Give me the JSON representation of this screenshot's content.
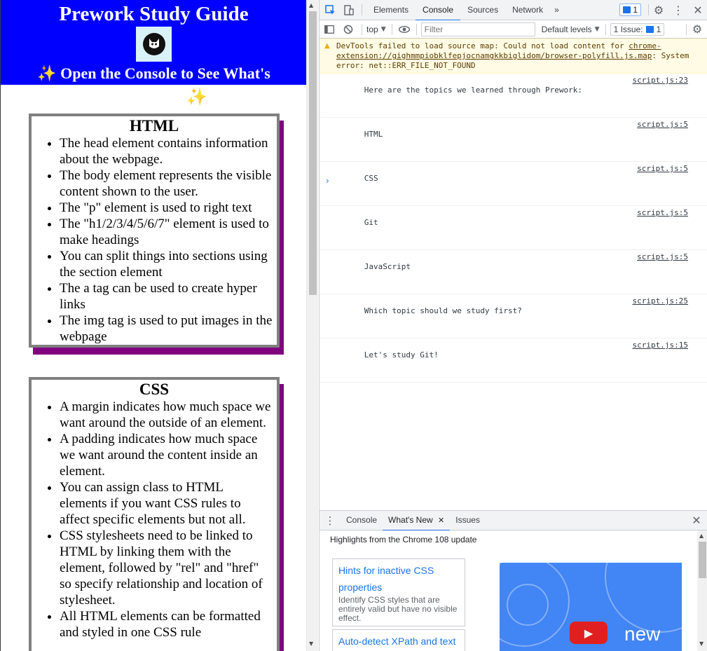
{
  "page": {
    "title": "Prework Study Guide",
    "subtitle": "Open the Console to See What's",
    "sparkle": "✨",
    "colors": {
      "banner": "#0000ff",
      "card_border": "#808080",
      "card_shadow": "#800080"
    },
    "cards": [
      {
        "heading": "HTML",
        "items": [
          "The head element contains information about the webpage.",
          "The body element represents the visible content shown to the user.",
          "The \"p\" element is used to right text",
          "The \"h1/2/3/4/5/6/7\" element is used to make headings",
          "You can split things into sections using the section element",
          "The a tag can be used to create hyper links",
          "The img tag is used to put images in the webpage"
        ]
      },
      {
        "heading": "CSS",
        "items": [
          "A margin indicates how much space we want around the outside of an element.",
          "A padding indicates how much space we want around the content inside an element.",
          "You can assign class to HTML elements if you want CSS rules to affect specific elements but not all.",
          "CSS stylesheets need to be linked to HTML by linking them with the element, followed by \"rel\" and \"href\" so specify relationship and location of stylesheet.",
          "All HTML elements can be formatted and styled in one CSS rule"
        ]
      }
    ]
  },
  "devtools": {
    "tabs": [
      "Elements",
      "Console",
      "Sources",
      "Network"
    ],
    "active_tab": "Console",
    "more_tabs": "»",
    "message_badge": "1",
    "toolbar": {
      "context": "top",
      "filter_placeholder": "Filter",
      "levels": "Default levels",
      "issues_label": "1 Issue:",
      "issues_count": "1"
    },
    "warning": {
      "text": "DevTools failed to load source map: Could not load content for ",
      "link": "chrome-extension://gighmmpiobklfepjocnamgkkbiglidom/browser-polyfill.js.map",
      "tail": ": System error: net::ERR_FILE_NOT_FOUND"
    },
    "messages": [
      {
        "text": "Here are the topics we learned through Prework:",
        "source": "script.js:23"
      },
      {
        "text": "HTML",
        "source": "script.js:5"
      },
      {
        "text": "CSS",
        "source": "script.js:5"
      },
      {
        "text": "Git",
        "source": "script.js:5"
      },
      {
        "text": "JavaScript",
        "source": "script.js:5"
      },
      {
        "text": "Which topic should we study first?",
        "source": "script.js:25"
      },
      {
        "text": "Let's study Git!",
        "source": "script.js:15"
      }
    ],
    "prompt": "›",
    "drawer": {
      "tabs": [
        "Console",
        "What's New",
        "Issues"
      ],
      "active_tab": "What's New",
      "highlights": "Highlights from the Chrome 108 update",
      "features": [
        {
          "title": "Hints for inactive CSS properties",
          "desc": "Identify CSS styles that are entirely valid but have no visible effect."
        },
        {
          "title": "Auto-detect XPath and text",
          "desc": ""
        }
      ],
      "video_label": "new"
    }
  }
}
